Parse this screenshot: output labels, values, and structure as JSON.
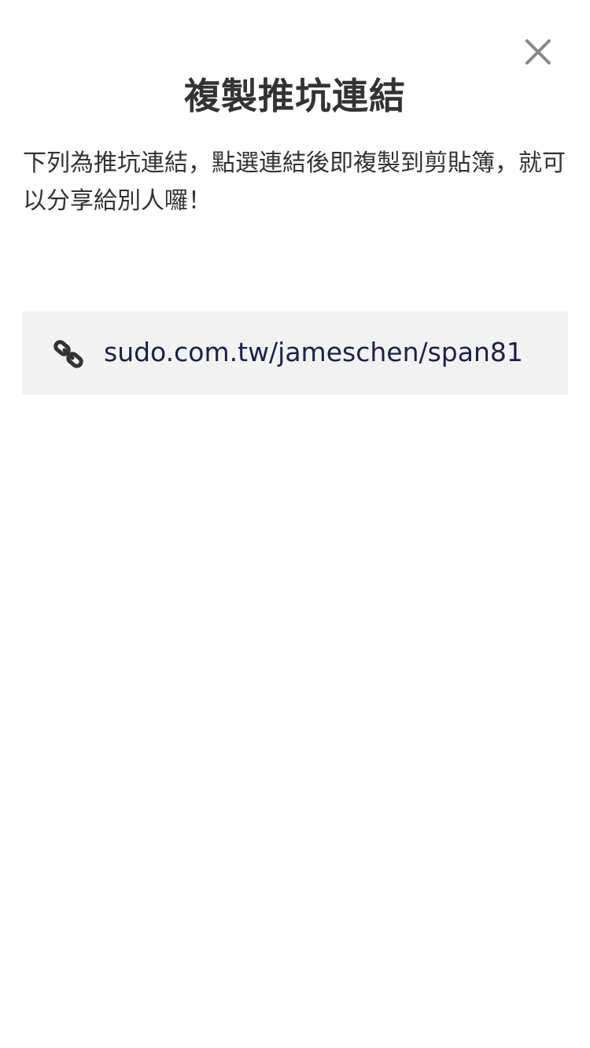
{
  "dialog": {
    "title": "複製推坑連結",
    "description": "下列為推坑連結，點選連結後即複製到剪貼簿，就可以分享給別人囉！",
    "close_icon": "close-icon"
  },
  "link": {
    "icon": "link-icon",
    "url_text": "sudo.com.tw/jameschen/span81"
  },
  "colors": {
    "title_text": "#333333",
    "link_text": "#1c2148",
    "link_background": "#f2f2f2",
    "close_icon": "#888888",
    "link_icon": "#333333"
  }
}
